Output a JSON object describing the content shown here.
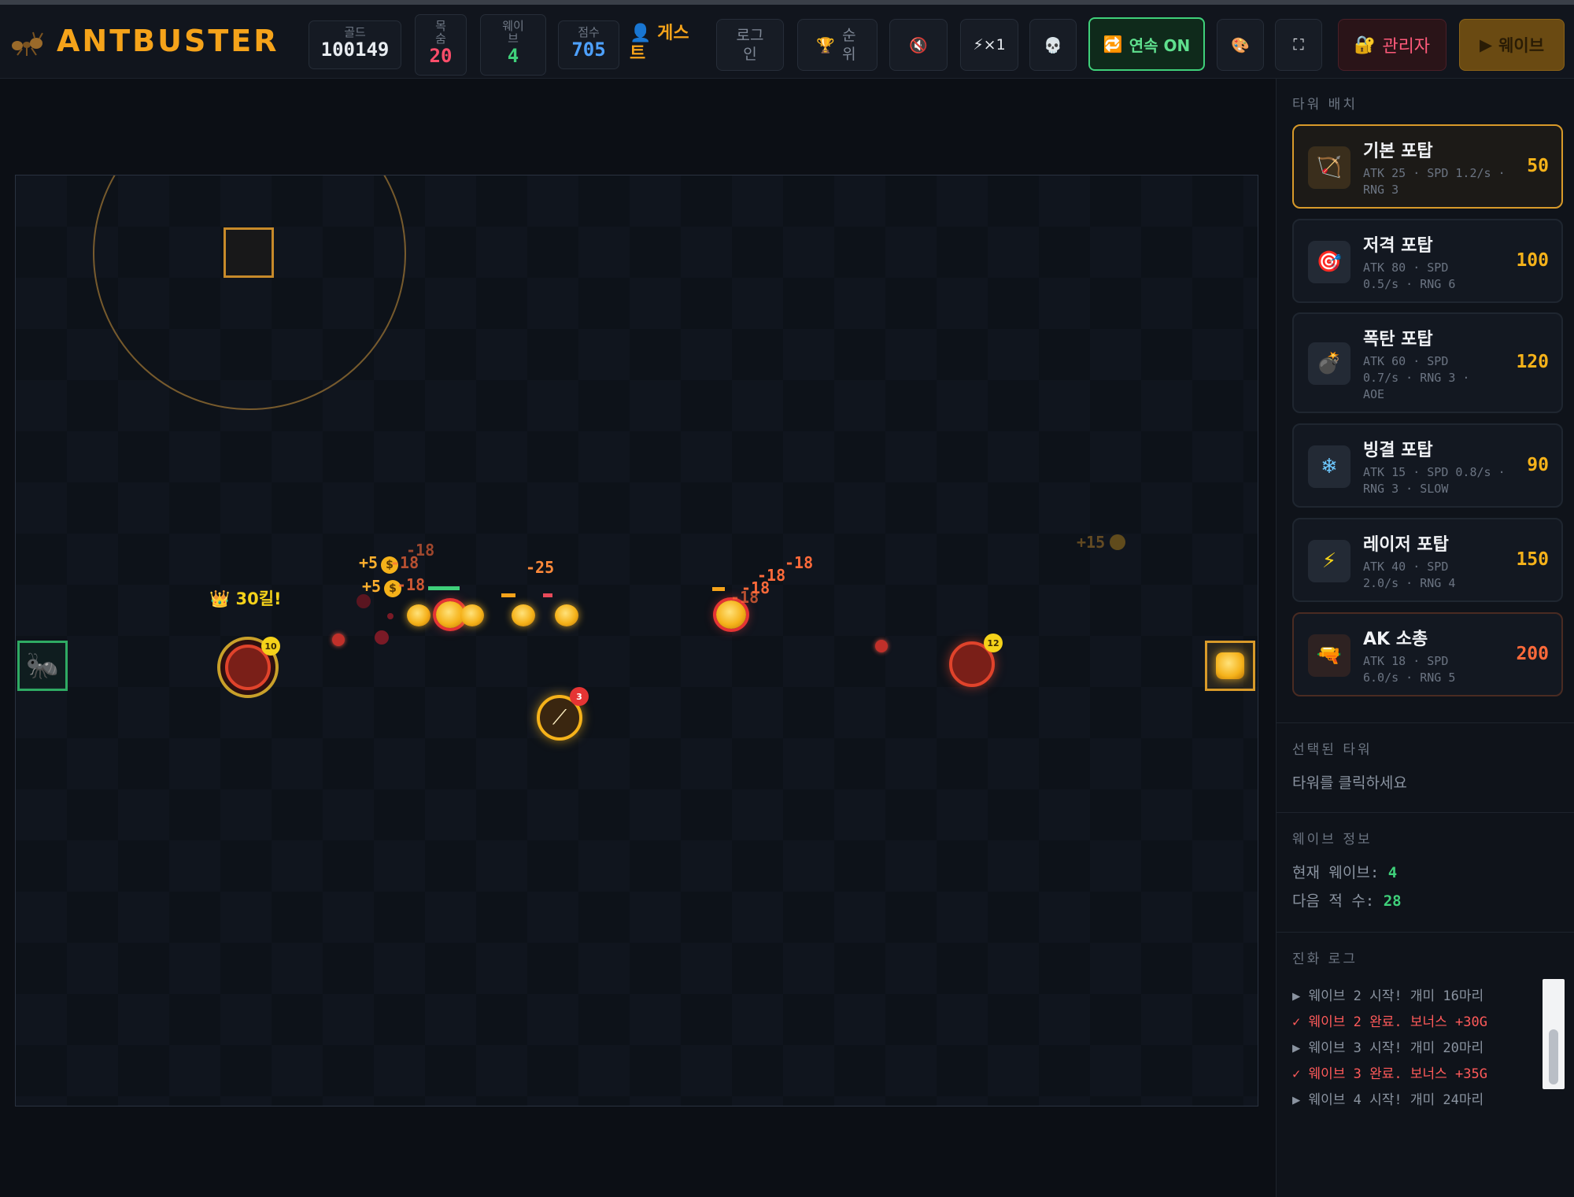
{
  "header": {
    "title": "ANTBUSTER",
    "stats": {
      "gold": {
        "label": "골드",
        "value": "100149"
      },
      "lives": {
        "label": "목숨",
        "value": "20"
      },
      "wave": {
        "label": "웨이브",
        "value": "4"
      },
      "score": {
        "label": "점수",
        "value": "705"
      }
    },
    "user_label": "게스트",
    "login_label": "로그인",
    "ranking_label": "순위",
    "speed_label": "×1",
    "continuous_label": "연속 ON",
    "admin_label": "관리자",
    "wave_button_label": "웨이브"
  },
  "board": {
    "kill_text": "30킬!",
    "damage_texts": [
      "-18",
      "-18",
      "-18",
      "-25",
      "-18",
      "-18",
      "-18",
      "-18"
    ],
    "gain_texts": [
      "+5",
      "+5",
      "+15"
    ],
    "tower_levels": [
      "10",
      "3",
      "12"
    ]
  },
  "sidebar": {
    "placement_title": "타워 배치",
    "towers": [
      {
        "name": "기본 포탑",
        "stats": "ATK 25 · SPD 1.2/s · RNG 3",
        "cost": "50",
        "icon": "bow-icon"
      },
      {
        "name": "저격 포탑",
        "stats": "ATK 80 · SPD 0.5/s · RNG 6",
        "cost": "100",
        "icon": "target-icon"
      },
      {
        "name": "폭탄 포탑",
        "stats": "ATK 60 · SPD 0.7/s · RNG 3 · AOE",
        "cost": "120",
        "icon": "bomb-icon"
      },
      {
        "name": "빙결 포탑",
        "stats": "ATK 15 · SPD 0.8/s · RNG 3 · SLOW",
        "cost": "90",
        "icon": "snowflake-icon"
      },
      {
        "name": "레이저 포탑",
        "stats": "ATK 40 · SPD 2.0/s · RNG 4",
        "cost": "150",
        "icon": "lightning-icon"
      },
      {
        "name": "AK 소총",
        "stats": "ATK 18 · SPD 6.0/s · RNG 5",
        "cost": "200",
        "icon": "gun-icon"
      }
    ],
    "selected_title": "선택된 타워",
    "selected_hint": "타워를 클릭하세요",
    "wave_info_title": "웨이브 정보",
    "current_wave_label": "현재 웨이브:",
    "current_wave_value": "4",
    "next_enemies_label": "다음 적 수:",
    "next_enemies_value": "28",
    "log_title": "진화 로그",
    "log": [
      {
        "type": "start",
        "text": "웨이브 2 시작! 개미 16마리"
      },
      {
        "type": "done",
        "text": "웨이브 2 완료. 보너스 +30G"
      },
      {
        "type": "start",
        "text": "웨이브 3 시작! 개미 20마리"
      },
      {
        "type": "done",
        "text": "웨이브 3 완료. 보너스 +35G"
      },
      {
        "type": "start",
        "text": "웨이브 4 시작! 개미 24마리"
      }
    ]
  },
  "colors": {
    "accent": "#f5a31a",
    "lives": "#ff4d6a",
    "wave": "#3fd07a",
    "score": "#4ea1ff",
    "admin": "#ff5a7a"
  }
}
